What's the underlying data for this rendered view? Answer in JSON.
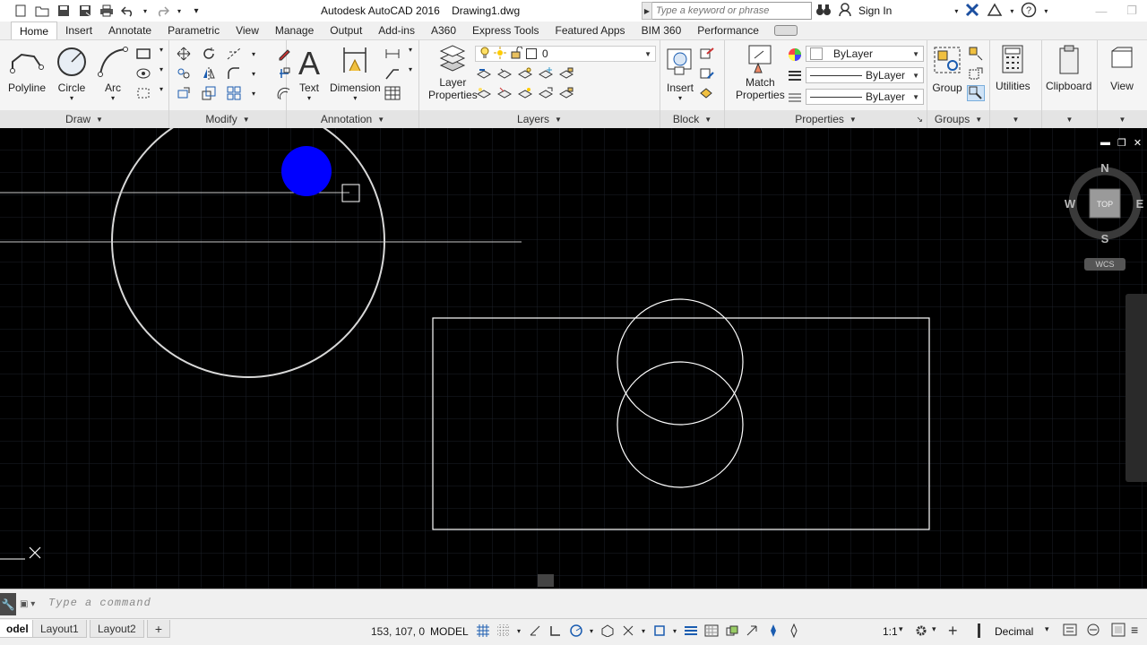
{
  "app": {
    "title": "Autodesk AutoCAD 2016",
    "document": "Drawing1.dwg"
  },
  "search": {
    "placeholder": "Type a keyword or phrase"
  },
  "account": {
    "signin_label": "Sign In"
  },
  "tabs": [
    "Home",
    "Insert",
    "Annotate",
    "Parametric",
    "View",
    "Manage",
    "Output",
    "Add-ins",
    "A360",
    "Express Tools",
    "Featured Apps",
    "BIM 360",
    "Performance"
  ],
  "active_tab": "Home",
  "ribbon": {
    "draw": {
      "title": "Draw",
      "polyline": "Polyline",
      "circle": "Circle",
      "arc": "Arc"
    },
    "modify": {
      "title": "Modify"
    },
    "annotation": {
      "title": "Annotation",
      "text": "Text",
      "dimension": "Dimension"
    },
    "layers": {
      "title": "Layers",
      "layer_props_1": "Layer",
      "layer_props_2": "Properties",
      "current_layer": "0"
    },
    "block": {
      "title": "Block",
      "insert": "Insert"
    },
    "properties": {
      "title": "Properties",
      "match_1": "Match",
      "match_2": "Properties",
      "color": "ByLayer",
      "linetype": "ByLayer",
      "lineweight": "ByLayer"
    },
    "groups": {
      "title": "Groups",
      "group": "Group"
    },
    "utilities": "Utilities",
    "clipboard": "Clipboard",
    "view": "View"
  },
  "viewcube": {
    "n": "N",
    "s": "S",
    "e": "E",
    "w": "W",
    "face": "TOP",
    "wcs": "WCS"
  },
  "command": {
    "placeholder": "Type a command"
  },
  "layout_tabs": [
    "odel",
    "Layout1",
    "Layout2"
  ],
  "status": {
    "coords": "153, 107, 0",
    "space": "MODEL",
    "scale": "1:1",
    "units": "Decimal"
  },
  "colors": {
    "canvas": "#000000",
    "grid": "#1a1f26",
    "accent_blue": "#0000ff"
  }
}
